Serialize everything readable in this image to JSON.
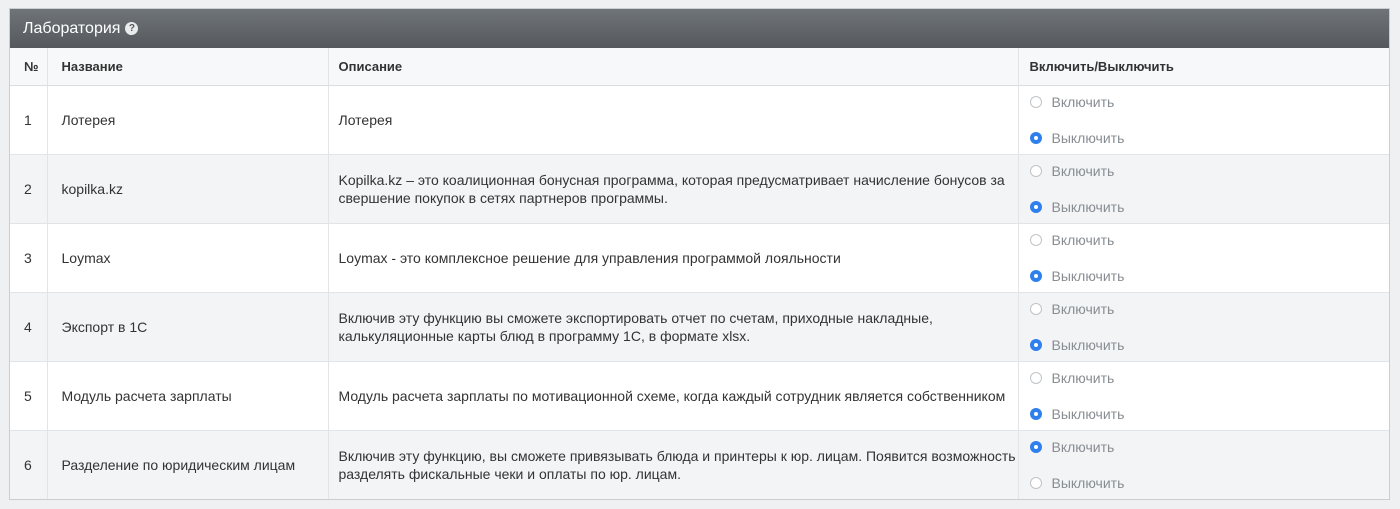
{
  "panel": {
    "title": "Лаборатория",
    "help_icon": "?"
  },
  "table": {
    "headers": {
      "num": "№",
      "name": "Название",
      "description": "Описание",
      "toggle": "Включить/Выключить"
    },
    "option_on": "Включить",
    "option_off": "Выключить",
    "rows": [
      {
        "num": "1",
        "name": "Лотерея",
        "description": "Лотерея",
        "enabled": false
      },
      {
        "num": "2",
        "name": "kopilka.kz",
        "description": "Kopilka.kz – это коалиционная бонусная программа, которая предусматривает начисление бонусов за свершение покупок в сетях партнеров программы.",
        "enabled": false
      },
      {
        "num": "3",
        "name": "Loymax",
        "description": "Loymax - это комплексное решение для управления программой лояльности",
        "enabled": false
      },
      {
        "num": "4",
        "name": "Экспорт в 1С",
        "description": "Включив эту функцию вы сможете экспортировать отчет по счетам, приходные накладные, калькуляционные карты блюд в программу 1С, в формате xlsx.",
        "enabled": false
      },
      {
        "num": "5",
        "name": "Модуль расчета зарплаты",
        "description": "Модуль расчета зарплаты по мотивационной схеме, когда каждый сотрудник является собственником",
        "enabled": false
      },
      {
        "num": "6",
        "name": "Разделение по юридическим лицам",
        "description": "Включив эту функцию, вы сможете привязывать блюда и принтеры к юр. лицам. Появится возможность разделять фискальные чеки и оплаты по юр. лицам.",
        "enabled": true
      }
    ]
  },
  "colors": {
    "header_bg": "#5f6367",
    "radio_checked": "#2f80ed",
    "row_stripe": "#f2f4f6"
  }
}
